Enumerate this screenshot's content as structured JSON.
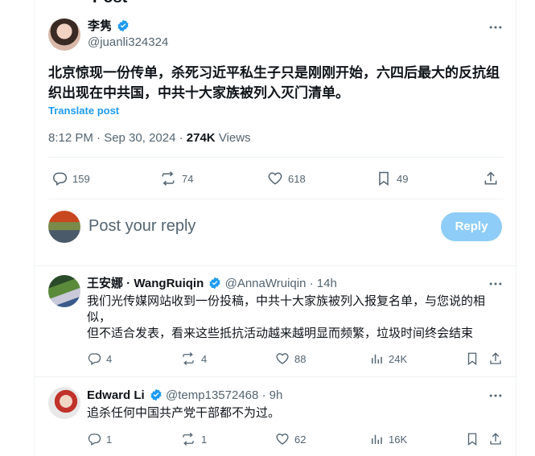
{
  "header": {
    "title": "Post"
  },
  "post": {
    "author_name": "李隽",
    "author_handle": "@juanli324324",
    "text": "北京惊现一份传单，杀死习近平私生子只是刚刚开始，六四后最大的反抗组织出现在中共国，中共十大家族被列入灭门清单。",
    "translate": "Translate post",
    "timestamp": "8:12 PM · Sep 30, 2024 ·",
    "views_count": "274K",
    "views_label": "Views",
    "replies": "159",
    "reposts": "74",
    "likes": "618",
    "bookmarks": "49"
  },
  "composer": {
    "placeholder": "Post your reply",
    "reply_button": "Reply"
  },
  "replies": [
    {
      "author_name": "王安娜 · WangRuiqin",
      "author_handle": "@AnnaWruiqin",
      "time": "· 14h",
      "lines": [
        "我们光传媒网站收到一份投稿，中共十大家族被列入报复名单，与您说的相似，",
        "但不适合发表，看来这些抵抗活动越来越明显而频繁，垃圾时间终会结束"
      ],
      "replies": "4",
      "reposts": "4",
      "likes": "88",
      "views": "24K"
    },
    {
      "author_name": "Edward Li",
      "author_handle": "@temp13572468",
      "time": "· 9h",
      "lines": [
        "追杀任何中国共产党干部都不为过。"
      ],
      "replies": "1",
      "reposts": "1",
      "likes": "62",
      "views": "16K"
    }
  ],
  "colors": {
    "accent": "#1d9bf0",
    "muted": "#536471",
    "reply_disabled": "#8ecdf8"
  }
}
